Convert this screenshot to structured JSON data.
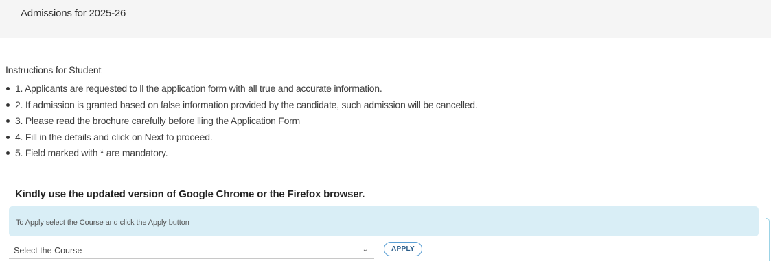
{
  "header": {
    "title": "Admissions for 2025-26"
  },
  "instructions": {
    "heading": "Instructions for Student",
    "items": [
      "1. Applicants are requested to ll the application form with all true and accurate information.",
      "2. If admission is granted based on false information provided by the candidate, such admission will be cancelled.",
      "3. Please read the brochure carefully before lling the Application Form",
      "4. Fill in the details and click on Next to proceed.",
      "5. Field marked with * are mandatory."
    ],
    "notice": "Kindly use the updated version of Google Chrome or the Firefox browser."
  },
  "apply": {
    "info_text": "To Apply select the Course and click the Apply button",
    "course_select_value": "Select the Course",
    "apply_label": "APPLY"
  },
  "colors": {
    "header_bg": "#f5f5f5",
    "info_panel_bg": "#d9eef6",
    "button_border": "#5a9fd4"
  },
  "icons": {
    "select_arrow": "chevron-down-icon",
    "bullet": "bullet-icon"
  }
}
